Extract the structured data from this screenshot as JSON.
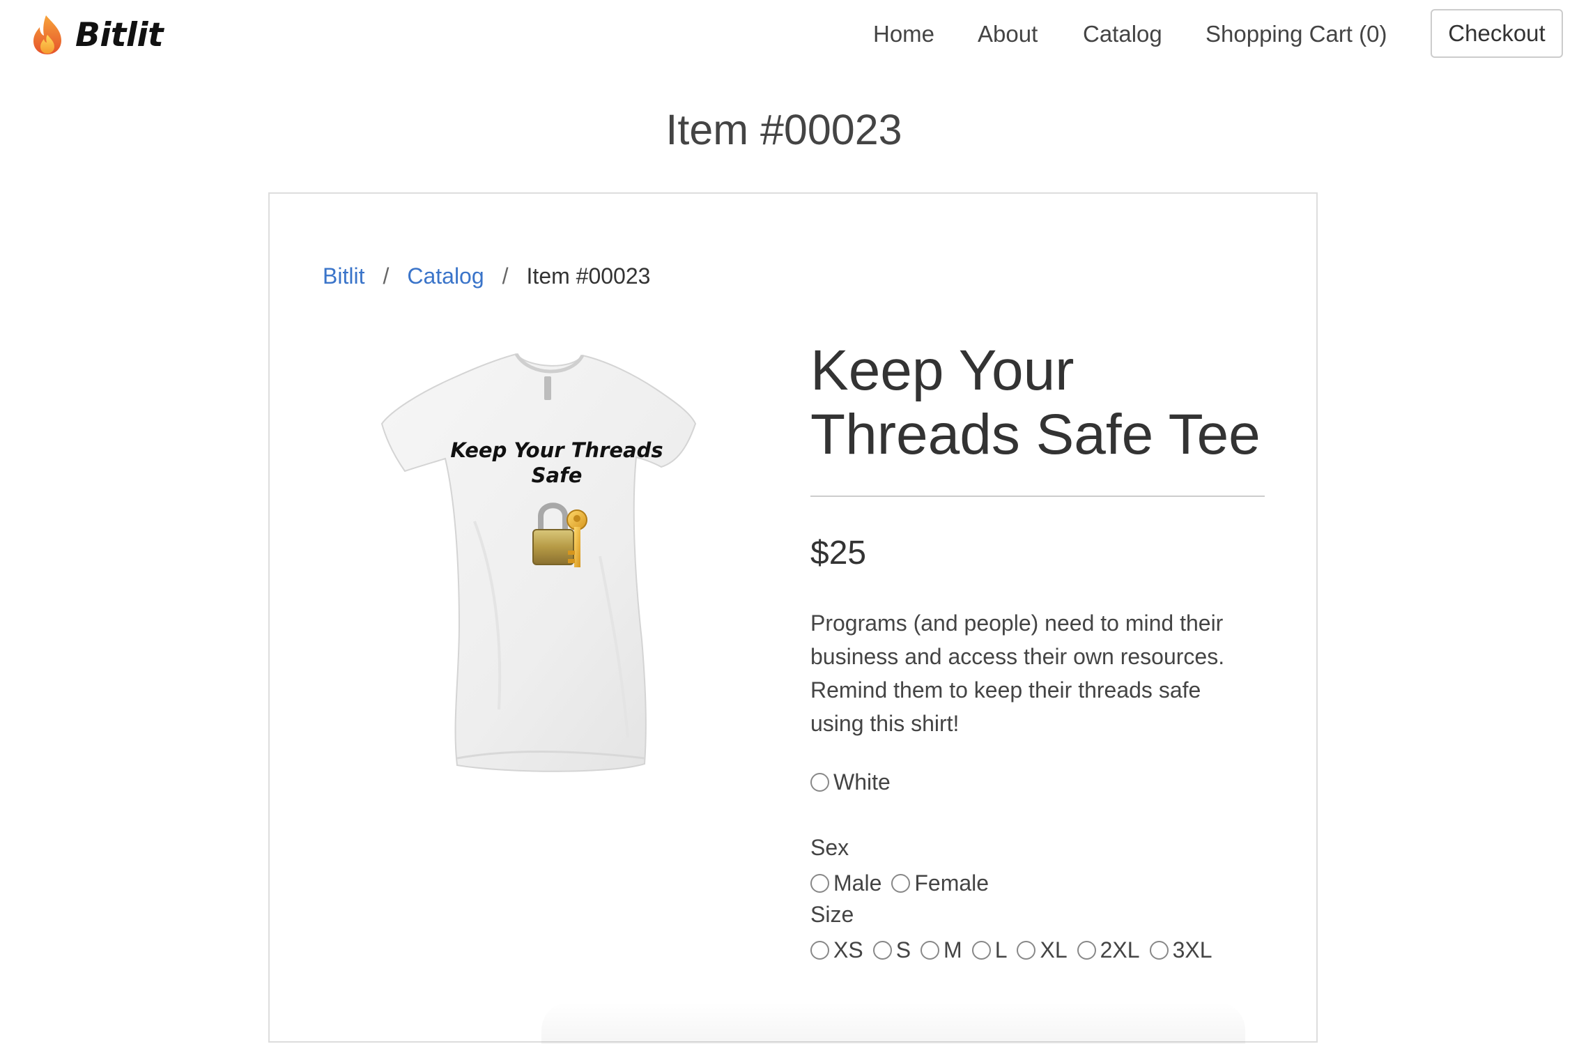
{
  "brand": {
    "name": "Bitlit",
    "logo_icon": "flame-icon"
  },
  "nav": {
    "home": "Home",
    "about": "About",
    "catalog": "Catalog",
    "cart": "Shopping Cart (0)",
    "checkout": "Checkout"
  },
  "page": {
    "title": "Item #00023"
  },
  "breadcrumb": {
    "root": "Bitlit",
    "catalog": "Catalog",
    "current": "Item #00023",
    "separator": "/"
  },
  "product": {
    "name_line1": "Keep Your",
    "name_line2": "Threads Safe Tee",
    "price": "$25",
    "description": "Programs (and people) need to mind their business and access their own resources. Remind them to keep their threads safe using this shirt!",
    "image": {
      "shirt_color": "#f1f1f1",
      "print_line1": "Keep Your Threads",
      "print_line2": "Safe",
      "print_icon": "lock-with-key-icon"
    }
  },
  "options": {
    "colors": [
      "White"
    ],
    "sex_label": "Sex",
    "sexes": [
      "Male",
      "Female"
    ],
    "size_label": "Size",
    "sizes": [
      "XS",
      "S",
      "M",
      "L",
      "XL",
      "2XL",
      "3XL"
    ]
  },
  "theme": {
    "link_color": "#3a74c9",
    "text_color": "#333333"
  }
}
